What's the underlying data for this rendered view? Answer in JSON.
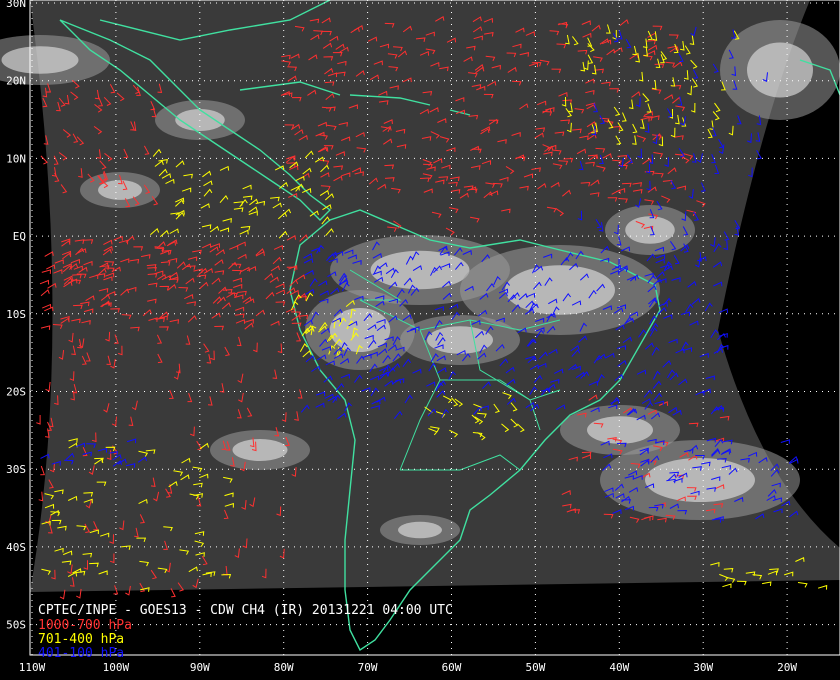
{
  "title": "CPTEC/INPE - GOES13 - CDW CH4 (IR) 20131221 04:00 UTC",
  "legend": [
    {
      "label": "1000-700 hPa",
      "color": "#ff3030"
    },
    {
      "label": "701-400 hPa",
      "color": "#ffff00"
    },
    {
      "label": "401-100 hPa",
      "color": "#1010ff"
    }
  ],
  "map": {
    "lon_range": [
      -110,
      -20
    ],
    "lat_range": [
      -55,
      30
    ],
    "lat_labels": [
      "30N",
      "20N",
      "10N",
      "EQ",
      "10S",
      "20S",
      "30S",
      "40S",
      "50S"
    ],
    "lat_values": [
      30,
      20,
      10,
      0,
      -10,
      -20,
      -30,
      -40,
      -50
    ],
    "lon_labels": [
      "110W",
      "100W",
      "90W",
      "80W",
      "70W",
      "60W",
      "50W",
      "40W",
      "30W",
      "20W"
    ],
    "lon_values": [
      -110,
      -100,
      -90,
      -80,
      -70,
      -60,
      -50,
      -40,
      -30,
      -20
    ],
    "gridline_color": "#ffffff",
    "coastline_color": "#40e0a0",
    "satellite_background": "#3a3a3a"
  }
}
